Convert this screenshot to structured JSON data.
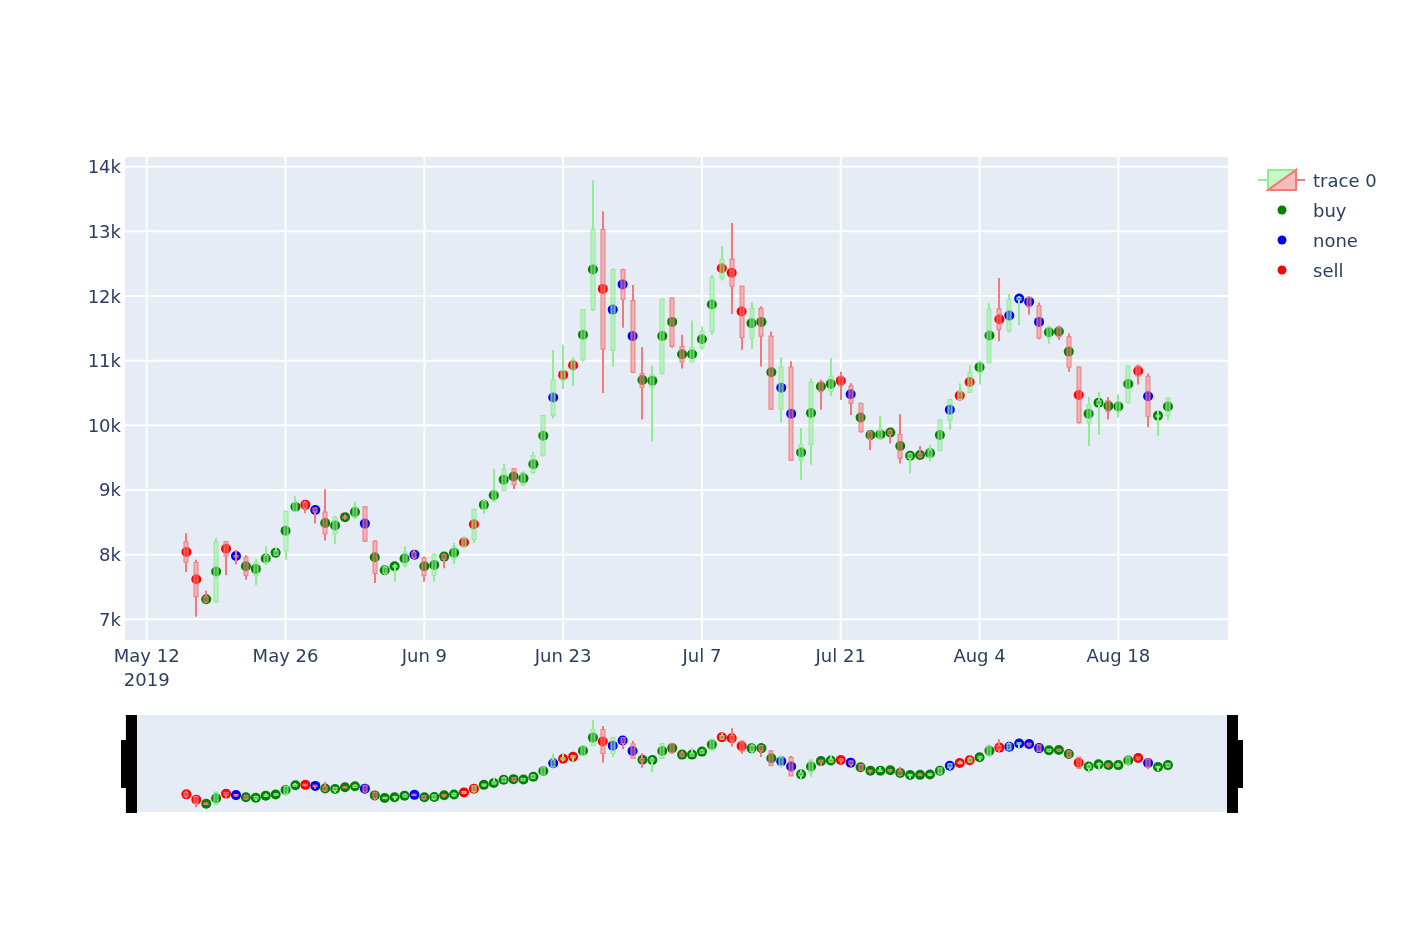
{
  "chart": {
    "legend": {
      "candlestick_label": "trace 0"
    },
    "chart_data": {
      "type": "candlestick",
      "grid": true,
      "x": [
        "2019-05-16",
        "2019-05-17",
        "2019-05-18",
        "2019-05-19",
        "2019-05-20",
        "2019-05-21",
        "2019-05-22",
        "2019-05-23",
        "2019-05-24",
        "2019-05-25",
        "2019-05-26",
        "2019-05-27",
        "2019-05-28",
        "2019-05-29",
        "2019-05-30",
        "2019-05-31",
        "2019-06-01",
        "2019-06-02",
        "2019-06-03",
        "2019-06-04",
        "2019-06-05",
        "2019-06-06",
        "2019-06-07",
        "2019-06-08",
        "2019-06-09",
        "2019-06-10",
        "2019-06-11",
        "2019-06-12",
        "2019-06-13",
        "2019-06-14",
        "2019-06-15",
        "2019-06-16",
        "2019-06-17",
        "2019-06-18",
        "2019-06-19",
        "2019-06-20",
        "2019-06-21",
        "2019-06-22",
        "2019-06-23",
        "2019-06-24",
        "2019-06-25",
        "2019-06-26",
        "2019-06-27",
        "2019-06-28",
        "2019-06-29",
        "2019-06-30",
        "2019-07-01",
        "2019-07-02",
        "2019-07-03",
        "2019-07-04",
        "2019-07-05",
        "2019-07-06",
        "2019-07-07",
        "2019-07-08",
        "2019-07-09",
        "2019-07-10",
        "2019-07-11",
        "2019-07-12",
        "2019-07-13",
        "2019-07-14",
        "2019-07-15",
        "2019-07-16",
        "2019-07-17",
        "2019-07-18",
        "2019-07-19",
        "2019-07-20",
        "2019-07-21",
        "2019-07-22",
        "2019-07-23",
        "2019-07-24",
        "2019-07-25",
        "2019-07-26",
        "2019-07-27",
        "2019-07-28",
        "2019-07-29",
        "2019-07-30",
        "2019-07-31",
        "2019-08-01",
        "2019-08-02",
        "2019-08-03",
        "2019-08-04",
        "2019-08-05",
        "2019-08-06",
        "2019-08-07",
        "2019-08-08",
        "2019-08-09",
        "2019-08-10",
        "2019-08-11",
        "2019-08-12",
        "2019-08-13",
        "2019-08-14",
        "2019-08-15",
        "2019-08-16",
        "2019-08-17",
        "2019-08-18",
        "2019-08-19",
        "2019-08-20",
        "2019-08-21",
        "2019-08-22",
        "2019-08-23"
      ],
      "ohlc": [
        [
          8200,
          8330,
          7730,
          7880
        ],
        [
          7880,
          7920,
          7040,
          7350
        ],
        [
          7350,
          7440,
          7250,
          7270
        ],
        [
          7270,
          8260,
          7260,
          8200
        ],
        [
          8200,
          8210,
          7680,
          7980
        ],
        [
          7980,
          8070,
          7850,
          7970
        ],
        [
          7960,
          7990,
          7610,
          7680
        ],
        [
          7680,
          7940,
          7530,
          7880
        ],
        [
          7880,
          8130,
          7840,
          7990
        ],
        [
          7990,
          8120,
          7980,
          8060
        ],
        [
          8060,
          8680,
          7920,
          8670
        ],
        [
          8670,
          8910,
          8660,
          8810
        ],
        [
          8810,
          8830,
          8640,
          8720
        ],
        [
          8720,
          8730,
          8480,
          8660
        ],
        [
          8660,
          9010,
          8220,
          8320
        ],
        [
          8320,
          8600,
          8170,
          8580
        ],
        [
          8580,
          8620,
          8540,
          8570
        ],
        [
          8570,
          8820,
          8550,
          8740
        ],
        [
          8740,
          8750,
          8200,
          8210
        ],
        [
          8210,
          8220,
          7560,
          7710
        ],
        [
          7710,
          7830,
          7690,
          7810
        ],
        [
          7810,
          7860,
          7580,
          7830
        ],
        [
          7830,
          8130,
          7800,
          8040
        ],
        [
          8040,
          8070,
          7930,
          7950
        ],
        [
          7950,
          7970,
          7580,
          7680
        ],
        [
          7680,
          8020,
          7580,
          8000
        ],
        [
          8000,
          8020,
          7790,
          7930
        ],
        [
          7930,
          8180,
          7860,
          8120
        ],
        [
          8120,
          8280,
          8100,
          8260
        ],
        [
          8230,
          8710,
          8180,
          8700
        ],
        [
          8700,
          8850,
          8630,
          8830
        ],
        [
          8830,
          9330,
          8810,
          9000
        ],
        [
          8990,
          9410,
          8990,
          9320
        ],
        [
          9330,
          9340,
          9010,
          9080
        ],
        [
          9080,
          9290,
          9060,
          9270
        ],
        [
          9270,
          9590,
          9250,
          9530
        ],
        [
          9530,
          10160,
          9520,
          10150
        ],
        [
          10150,
          11160,
          10110,
          10700
        ],
        [
          10700,
          11250,
          10560,
          10850
        ],
        [
          10850,
          11060,
          10610,
          11010
        ],
        [
          11010,
          11800,
          10990,
          11790
        ],
        [
          11790,
          13790,
          11770,
          13030
        ],
        [
          13030,
          13310,
          10500,
          11180
        ],
        [
          11160,
          12430,
          10910,
          12410
        ],
        [
          12410,
          12420,
          11510,
          11950
        ],
        [
          11930,
          12170,
          10810,
          10820
        ],
        [
          10800,
          11210,
          10090,
          10590
        ],
        [
          10590,
          10920,
          9750,
          10780
        ],
        [
          10800,
          11960,
          10790,
          11950
        ],
        [
          11970,
          11980,
          11200,
          11220
        ],
        [
          11220,
          11400,
          10880,
          10980
        ],
        [
          10980,
          11620,
          10970,
          11210
        ],
        [
          11210,
          11530,
          11170,
          11450
        ],
        [
          11450,
          12330,
          11400,
          12290
        ],
        [
          12280,
          12770,
          12240,
          12570
        ],
        [
          12570,
          13130,
          11720,
          12150
        ],
        [
          12150,
          12160,
          11170,
          11360
        ],
        [
          11350,
          11900,
          11180,
          11810
        ],
        [
          11810,
          11840,
          10910,
          11380
        ],
        [
          11380,
          11450,
          10240,
          10250
        ],
        [
          10250,
          11050,
          10040,
          10900
        ],
        [
          10900,
          10990,
          9450,
          9460
        ],
        [
          9460,
          9960,
          9160,
          9700
        ],
        [
          9700,
          10730,
          9390,
          10670
        ],
        [
          10670,
          10710,
          10240,
          10520
        ],
        [
          10520,
          11040,
          10450,
          10760
        ],
        [
          10760,
          10830,
          10390,
          10610
        ],
        [
          10610,
          10650,
          10160,
          10340
        ],
        [
          10340,
          10350,
          9890,
          9900
        ],
        [
          9900,
          9920,
          9620,
          9800
        ],
        [
          9800,
          10150,
          9780,
          9920
        ],
        [
          9920,
          9940,
          9720,
          9860
        ],
        [
          9860,
          10170,
          9410,
          9490
        ],
        [
          9490,
          9580,
          9260,
          9560
        ],
        [
          9560,
          9680,
          9490,
          9510
        ],
        [
          9510,
          9700,
          9440,
          9620
        ],
        [
          9610,
          10090,
          9600,
          10080
        ],
        [
          10080,
          10410,
          9930,
          10400
        ],
        [
          10400,
          10650,
          10390,
          10520
        ],
        [
          10510,
          10930,
          10500,
          10820
        ],
        [
          10820,
          11000,
          10630,
          10980
        ],
        [
          10970,
          11890,
          10960,
          11800
        ],
        [
          11800,
          12280,
          11300,
          11480
        ],
        [
          11460,
          12030,
          11440,
          11940
        ],
        [
          11940,
          12000,
          11550,
          11980
        ],
        [
          11980,
          12000,
          11710,
          11830
        ],
        [
          11850,
          11900,
          11330,
          11350
        ],
        [
          11350,
          11540,
          11260,
          11520
        ],
        [
          11520,
          11540,
          11320,
          11370
        ],
        [
          11370,
          11420,
          10830,
          10900
        ],
        [
          10900,
          10910,
          10030,
          10040
        ],
        [
          10040,
          10440,
          9680,
          10320
        ],
        [
          10320,
          10520,
          9850,
          10380
        ],
        [
          10380,
          10440,
          10090,
          10210
        ],
        [
          10210,
          10480,
          10120,
          10370
        ],
        [
          10350,
          10930,
          10340,
          10920
        ],
        [
          10920,
          10940,
          10630,
          10760
        ],
        [
          10760,
          10800,
          9970,
          10140
        ],
        [
          10140,
          10220,
          9840,
          10150
        ],
        [
          10150,
          10430,
          10080,
          10420
        ]
      ],
      "xlim": [
        "2019-05-09T19:22:00Z",
        "2019-08-29T01:26:00Z"
      ],
      "ylim": [
        6680,
        14150
      ],
      "xticks": [
        {
          "value": "2019-05-12",
          "label": "May 12\n2019"
        },
        {
          "value": "2019-05-26",
          "label": "May 26"
        },
        {
          "value": "2019-06-09",
          "label": "Jun 9"
        },
        {
          "value": "2019-06-23",
          "label": "Jun 23"
        },
        {
          "value": "2019-07-07",
          "label": "Jul 7"
        },
        {
          "value": "2019-07-21",
          "label": "Jul 21"
        },
        {
          "value": "2019-08-04",
          "label": "Aug 4"
        },
        {
          "value": "2019-08-18",
          "label": "Aug 18"
        }
      ],
      "yticks": [
        {
          "value": 7000,
          "label": "7k"
        },
        {
          "value": 8000,
          "label": "8k"
        },
        {
          "value": 9000,
          "label": "9k"
        },
        {
          "value": 10000,
          "label": "10k"
        },
        {
          "value": 11000,
          "label": "11k"
        },
        {
          "value": 12000,
          "label": "12k"
        },
        {
          "value": 13000,
          "label": "13k"
        },
        {
          "value": 14000,
          "label": "14k"
        }
      ]
    },
    "signals": {
      "chart_data": {
        "type": "scatter",
        "x": [
          "2019-05-16",
          "2019-05-17",
          "2019-05-18",
          "2019-05-19",
          "2019-05-20",
          "2019-05-21",
          "2019-05-22",
          "2019-05-23",
          "2019-05-24",
          "2019-05-25",
          "2019-05-26",
          "2019-05-27",
          "2019-05-28",
          "2019-05-29",
          "2019-05-30",
          "2019-05-31",
          "2019-06-01",
          "2019-06-02",
          "2019-06-03",
          "2019-06-04",
          "2019-06-05",
          "2019-06-06",
          "2019-06-07",
          "2019-06-08",
          "2019-06-09",
          "2019-06-10",
          "2019-06-11",
          "2019-06-12",
          "2019-06-13",
          "2019-06-14",
          "2019-06-15",
          "2019-06-16",
          "2019-06-17",
          "2019-06-18",
          "2019-06-19",
          "2019-06-20",
          "2019-06-21",
          "2019-06-22",
          "2019-06-23",
          "2019-06-24",
          "2019-06-25",
          "2019-06-26",
          "2019-06-27",
          "2019-06-28",
          "2019-06-29",
          "2019-06-30",
          "2019-07-01",
          "2019-07-02",
          "2019-07-03",
          "2019-07-04",
          "2019-07-05",
          "2019-07-06",
          "2019-07-07",
          "2019-07-08",
          "2019-07-09",
          "2019-07-10",
          "2019-07-11",
          "2019-07-12",
          "2019-07-13",
          "2019-07-14",
          "2019-07-15",
          "2019-07-16",
          "2019-07-17",
          "2019-07-18",
          "2019-07-19",
          "2019-07-20",
          "2019-07-21",
          "2019-07-22",
          "2019-07-23",
          "2019-07-24",
          "2019-07-25",
          "2019-07-26",
          "2019-07-27",
          "2019-07-28",
          "2019-07-29",
          "2019-07-30",
          "2019-07-31",
          "2019-08-01",
          "2019-08-02",
          "2019-08-03",
          "2019-08-04",
          "2019-08-05",
          "2019-08-06",
          "2019-08-07",
          "2019-08-08",
          "2019-08-09",
          "2019-08-10",
          "2019-08-11",
          "2019-08-12",
          "2019-08-13",
          "2019-08-14",
          "2019-08-15",
          "2019-08-16",
          "2019-08-17",
          "2019-08-18",
          "2019-08-19",
          "2019-08-20",
          "2019-08-21",
          "2019-08-22",
          "2019-08-23"
        ],
        "series": [
          {
            "name": "buy",
            "color": "#008000",
            "values": [
              null,
              null,
              7310,
              7740,
              null,
              null,
              7820,
              7780,
              7940,
              8030,
              8370,
              8740,
              null,
              null,
              8490,
              8450,
              8580,
              8660,
              null,
              7960,
              7760,
              7820,
              7940,
              null,
              7820,
              7840,
              7970,
              8030,
              null,
              null,
              8770,
              8920,
              9160,
              9210,
              9180,
              9400,
              9840,
              null,
              null,
              null,
              11400,
              12410,
              null,
              null,
              null,
              null,
              10700,
              10690,
              11380,
              11600,
              11100,
              11100,
              11330,
              11870,
              null,
              null,
              null,
              11580,
              11600,
              10820,
              null,
              null,
              9580,
              10190,
              10600,
              10640,
              null,
              null,
              10120,
              9850,
              9860,
              9890,
              9680,
              9530,
              9540,
              9570,
              9850,
              null,
              null,
              null,
              10900,
              11390,
              null,
              null,
              null,
              null,
              null,
              11440,
              11450,
              11140,
              null,
              10180,
              10350,
              10300,
              10290,
              10640,
              null,
              null,
              10150,
              10290
            ]
          },
          {
            "name": "none",
            "color": "#0000ff",
            "values": [
              null,
              null,
              null,
              null,
              null,
              7980,
              null,
              null,
              null,
              null,
              null,
              null,
              null,
              8690,
              null,
              null,
              null,
              null,
              8480,
              null,
              null,
              null,
              null,
              8000,
              null,
              null,
              null,
              null,
              null,
              null,
              null,
              null,
              null,
              null,
              null,
              null,
              null,
              10430,
              null,
              null,
              null,
              null,
              null,
              11790,
              12180,
              11380,
              null,
              null,
              null,
              null,
              null,
              null,
              null,
              null,
              null,
              null,
              null,
              null,
              null,
              null,
              10580,
              10180,
              null,
              null,
              null,
              null,
              null,
              10480,
              null,
              null,
              null,
              null,
              null,
              null,
              null,
              null,
              null,
              10240,
              null,
              null,
              null,
              null,
              null,
              11700,
              11960,
              11910,
              11600,
              null,
              null,
              null,
              null,
              null,
              null,
              null,
              null,
              null,
              null,
              10450,
              null,
              null
            ]
          },
          {
            "name": "sell",
            "color": "#ff0000",
            "values": [
              8040,
              7620,
              null,
              null,
              8090,
              null,
              null,
              null,
              null,
              null,
              null,
              null,
              8770,
              null,
              null,
              null,
              null,
              null,
              null,
              null,
              null,
              null,
              null,
              null,
              null,
              null,
              null,
              null,
              8190,
              8470,
              null,
              null,
              null,
              null,
              null,
              null,
              null,
              null,
              10780,
              10930,
              null,
              null,
              12110,
              null,
              null,
              null,
              null,
              null,
              null,
              null,
              null,
              null,
              null,
              null,
              12430,
              12360,
              11760,
              null,
              null,
              null,
              null,
              null,
              null,
              null,
              null,
              null,
              10690,
              null,
              null,
              null,
              null,
              null,
              null,
              null,
              null,
              null,
              null,
              null,
              10460,
              10670,
              null,
              null,
              11640,
              null,
              null,
              null,
              null,
              null,
              null,
              null,
              10470,
              null,
              null,
              null,
              null,
              null,
              10840,
              null,
              null,
              null
            ]
          }
        ],
        "xlim": [
          "2019-05-09T19:22:00Z",
          "2019-08-29T01:26:00Z"
        ],
        "ylim": [
          6680,
          14150
        ]
      }
    }
  }
}
